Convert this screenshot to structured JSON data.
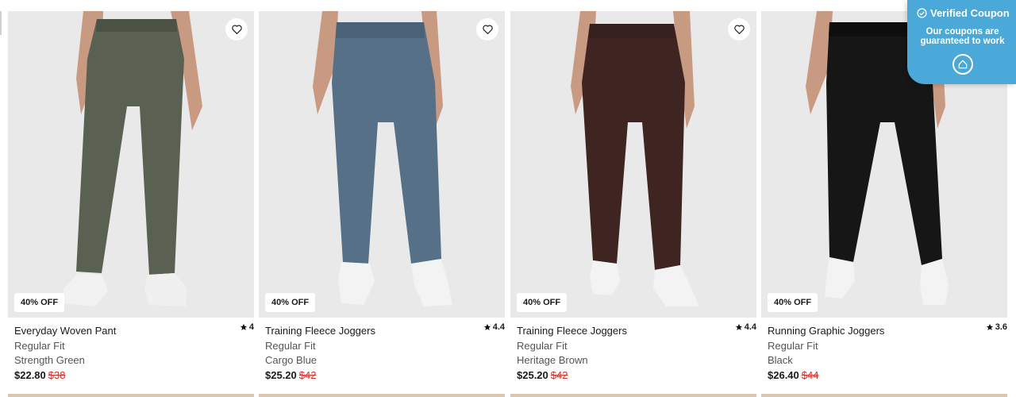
{
  "coupon": {
    "title": "Verified Coupon",
    "subtitle": "Our coupons are guaranteed to work",
    "icons": [
      "check-circle-icon",
      "coupon-logo-icon"
    ]
  },
  "products": [
    {
      "name": "Everyday Woven Pant",
      "fit": "Regular Fit",
      "color": "Strength Green",
      "price": "$22.80",
      "original_price": "$38",
      "rating": "4",
      "discount": "40% OFF",
      "pant_color": "#5a6152"
    },
    {
      "name": "Training Fleece Joggers",
      "fit": "Regular Fit",
      "color": "Cargo Blue",
      "price": "$25.20",
      "original_price": "$42",
      "rating": "4.4",
      "discount": "40% OFF",
      "pant_color": "#557087"
    },
    {
      "name": "Training Fleece Joggers",
      "fit": "Regular Fit",
      "color": "Heritage Brown",
      "price": "$25.20",
      "original_price": "$42",
      "rating": "4.4",
      "discount": "40% OFF",
      "pant_color": "#3e2522"
    },
    {
      "name": "Running Graphic Joggers",
      "fit": "Regular Fit",
      "color": "Black",
      "price": "$26.40",
      "original_price": "$44",
      "rating": "3.6",
      "discount": "40% OFF",
      "pant_color": "#161616"
    }
  ],
  "colors": {
    "sale_red": "#d0312d",
    "coupon_blue": "#4aa9d8",
    "image_bg": "#e9e9e9"
  }
}
